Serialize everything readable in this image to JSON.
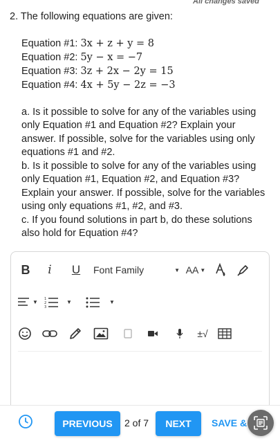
{
  "status": "All changes saved",
  "question": {
    "title": "2. The following equations are given:",
    "equations": [
      {
        "label": "Equation #1:",
        "math": "3x + z + y = 8"
      },
      {
        "label": "Equation #2:",
        "math": "5y − x = −7"
      },
      {
        "label": "Equation #3:",
        "math": "3z + 2x − 2y = 15"
      },
      {
        "label": "Equation #4:",
        "math": "4x + 5y − 2z = −3"
      }
    ],
    "parts": [
      "a. Is it possible to solve for any of the variables using only Equation #1 and Equation #2? Explain your answer. If possible, solve for the variables using only equations #1 and #2.",
      "b. Is it possible to solve for any of the variables using only Equation #1, Equation #2, and Equation #3? Explain your answer. If possible, solve for the variables using only equations #1, #2, and #3.",
      "c. If you found solutions in part b, do these solutions also hold for Equation #4?"
    ]
  },
  "toolbar": {
    "bold": "B",
    "italic": "i",
    "underline": "U",
    "font_family": "Font Family",
    "font_size": "AA",
    "formula": "±√",
    "icons": [
      "bold-icon",
      "italic-icon",
      "underline-icon",
      "font-size-icon",
      "text-color-icon",
      "highlight-icon",
      "align-icon",
      "numbered-list-icon",
      "bullet-list-icon",
      "emoji-icon",
      "link-icon",
      "pencil-icon",
      "image-icon",
      "checkbox-icon",
      "video-icon",
      "microphone-icon",
      "formula-icon",
      "table-icon"
    ]
  },
  "footer": {
    "previous": "PREVIOUS",
    "page": "2 of 7",
    "next": "NEXT",
    "save": "SAVE & E",
    "icons": [
      "clock-icon",
      "scan-icon"
    ]
  },
  "colors": {
    "accent": "#2196f3",
    "text": "#222222",
    "float_button": "#6b6b6b"
  }
}
